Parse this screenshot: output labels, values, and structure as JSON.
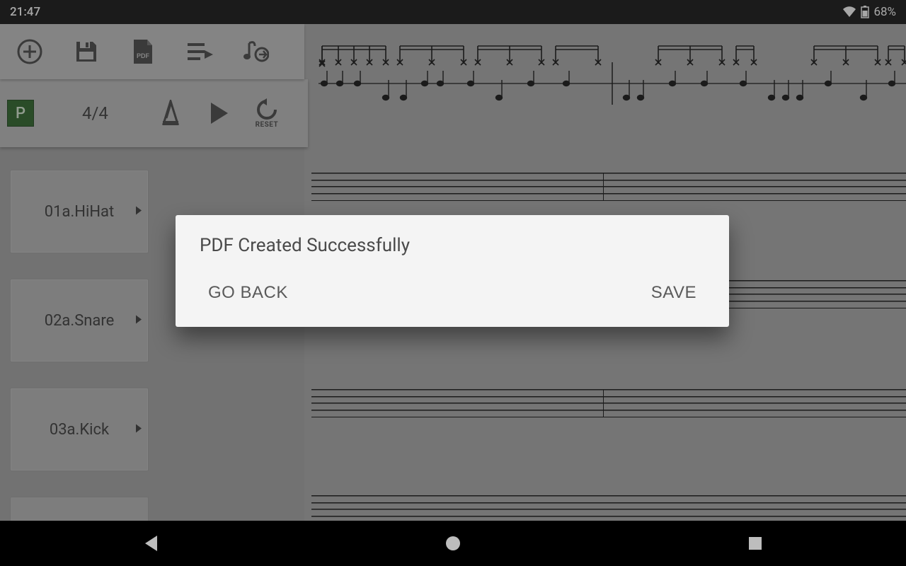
{
  "status": {
    "time": "21:47",
    "battery": "68%"
  },
  "toolbar": {
    "add": "add",
    "save": "save",
    "pdf_badge": "PDF",
    "queue": "queue",
    "swap": "swap"
  },
  "transport": {
    "p_label": "P",
    "time_signature": "4/4",
    "metronome": "metronome",
    "play": "play",
    "reset": "reset",
    "reset_label": "RESET"
  },
  "tracks": [
    {
      "label": "01a.HiHat"
    },
    {
      "label": "02a.Snare"
    },
    {
      "label": "03a.Kick"
    }
  ],
  "dialog": {
    "title": "PDF Created Successfully",
    "go_back": "GO BACK",
    "save": "SAVE"
  }
}
